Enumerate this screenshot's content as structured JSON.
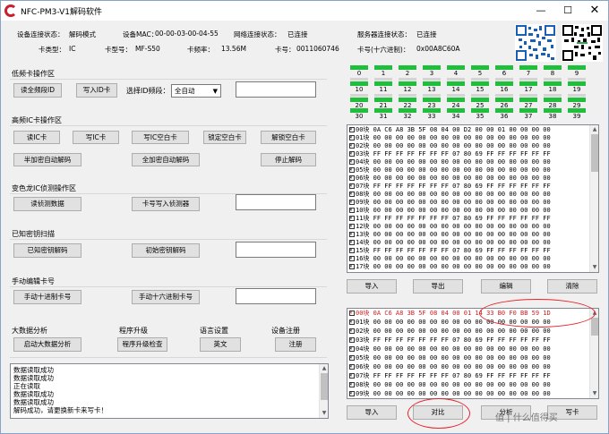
{
  "window": {
    "title": "NFC-PM3-V1解码软件",
    "minimize": "—",
    "maximize": "☐",
    "close": "✕"
  },
  "info": {
    "conn_status_label": "设备连接状态：",
    "conn_status": "解码模式",
    "mac_label": "设备MAC：",
    "mac": "00-00-03-00-04-55",
    "net_label": "网络连接状态：",
    "net": "已连接",
    "server_label": "服务器连接状态：",
    "server": "已连接",
    "card_type_label": "卡类型：",
    "card_type": "IC",
    "card_model_label": "卡型号：",
    "card_model": "MF-S50",
    "freq_label": "卡频率：",
    "freq": "13.56M",
    "card_no_label": "卡号：",
    "card_no": "0011060746",
    "card_hex_label": "卡号(十六进制)：",
    "card_hex": "0x00A8C60A"
  },
  "sections": {
    "low_freq": {
      "title": "低频卡操作区",
      "read_id": "读全频段ID",
      "write_id": "写入ID卡",
      "freq_label": "选择ID频段：",
      "freq_value": "全自动"
    },
    "hf_ic": {
      "title": "高频IC卡操作区",
      "read_ic": "读IC卡",
      "write_ic": "写IC卡",
      "write_blank": "写IC空白卡",
      "lock_blank": "锁定空白卡",
      "unlock_blank": "解锁空白卡",
      "manual_decrypt": "半加密自动解码",
      "full_decrypt": "全加密自动解码",
      "stop_decrypt": "停止解码"
    },
    "chameleon": {
      "title": "变色龙IC侦测操作区",
      "read_sniff": "读侦测数据",
      "write_sniff": "卡号写入侦测器"
    },
    "known_key": {
      "title": "已知密钥扫描",
      "known_decrypt": "已知密钥解码",
      "init_decrypt": "初始密钥解码"
    },
    "manual_edit": {
      "title": "手动编辑卡号",
      "manual_dec": "手动十进制卡号",
      "manual_hex": "手动十六进制卡号"
    },
    "big_data": {
      "title": "大数据分析",
      "start": "启动大数据分析"
    },
    "upgrade": {
      "title": "程序升级",
      "check": "程序升级检查"
    },
    "language": {
      "title": "语言设置",
      "english": "英文"
    },
    "register": {
      "title": "设备注册",
      "register": "注册"
    }
  },
  "sector_numbers": [
    "0",
    "1",
    "2",
    "3",
    "4",
    "5",
    "6",
    "7",
    "8",
    "9",
    "10",
    "11",
    "12",
    "13",
    "14",
    "15",
    "16",
    "17",
    "18",
    "19",
    "20",
    "21",
    "22",
    "23",
    "24",
    "25",
    "26",
    "27",
    "28",
    "29",
    "30",
    "31",
    "32",
    "33",
    "34",
    "35",
    "36",
    "37",
    "38",
    "39"
  ],
  "top_grid": {
    "rows": [
      "00块 0A C6 A8 3B 5F 08 04 00 D2 00 00 01 00 00 00 00",
      "01块 00 00 00 00 00 00 00 00 00 00 00 00 00 00 00 00",
      "02块 00 00 00 00 00 00 00 00 00 00 00 00 00 00 00 00",
      "03块 FF FF FF FF FF FF FF 07 80 69 FF FF FF FF FF FF",
      "04块 00 00 00 00 00 00 00 00 00 00 00 00 00 00 00 00",
      "05块 00 00 00 00 00 00 00 00 00 00 00 00 00 00 00 00",
      "06块 00 00 00 00 00 00 00 00 00 00 00 00 00 00 00 00",
      "07块 FF FF FF FF FF FF FF 07 80 69 FF FF FF FF FF FF",
      "08块 00 00 00 00 00 00 00 00 00 00 00 00 00 00 00 00",
      "09块 00 00 00 00 00 00 00 00 00 00 00 00 00 00 00 00",
      "10块 00 00 00 00 00 00 00 00 00 00 00 00 00 00 00 00",
      "11块 FF FF FF FF FF FF FF 07 80 69 FF FF FF FF FF FF",
      "12块 00 00 00 00 00 00 00 00 00 00 00 00 00 00 00 00",
      "13块 00 00 00 00 00 00 00 00 00 00 00 00 00 00 00 00",
      "14块 00 00 00 00 00 00 00 00 00 00 00 00 00 00 00 00",
      "15块 FF FF FF FF FF FF FF 07 80 69 FF FF FF FF FF FF",
      "16块 00 00 00 00 00 00 00 00 00 00 00 00 00 00 00 00",
      "17块 00 00 00 00 00 00 00 00 00 00 00 00 00 00 00 00"
    ]
  },
  "top_buttons": {
    "import": "导入",
    "export": "导出",
    "edit": "编辑",
    "clear": "清除"
  },
  "bottom_grid": {
    "rows": [
      "00块 0A C6 A8 3B 5F 08 04 00 01 14 33 B0 F0 BB 59 1D",
      "01块 00 00 00 00 00 00 00 00 00 00 00 00 00 00 00 00",
      "02块 00 00 00 00 00 00 00 00 00 00 00 00 00 00 00 00",
      "03块 FF FF FF FF FF FF FF 07 80 69 FF FF FF FF FF FF",
      "04块 00 00 00 00 00 00 00 00 00 00 00 00 00 00 00 00",
      "05块 00 00 00 00 00 00 00 00 00 00 00 00 00 00 00 00",
      "06块 00 00 00 00 00 00 00 00 00 00 00 00 00 00 00 00",
      "07块 FF FF FF FF FF FF FF 07 80 69 FF FF FF FF FF FF",
      "08块 00 00 00 00 00 00 00 00 00 00 00 00 00 00 00 00",
      "09块 00 00 00 00 00 00 00 00 00 00 00 00 00 00 00 00"
    ]
  },
  "bottom_buttons": {
    "import": "导入",
    "compare": "对比",
    "analyze": "分析",
    "write": "写卡"
  },
  "log": [
    "数据读取成功",
    "数据读取成功",
    "正在读取",
    "数据读取成功",
    "数据读取成功",
    "解码成功，请更换新卡来写卡！"
  ],
  "watermark": "值 | 什么值得买"
}
